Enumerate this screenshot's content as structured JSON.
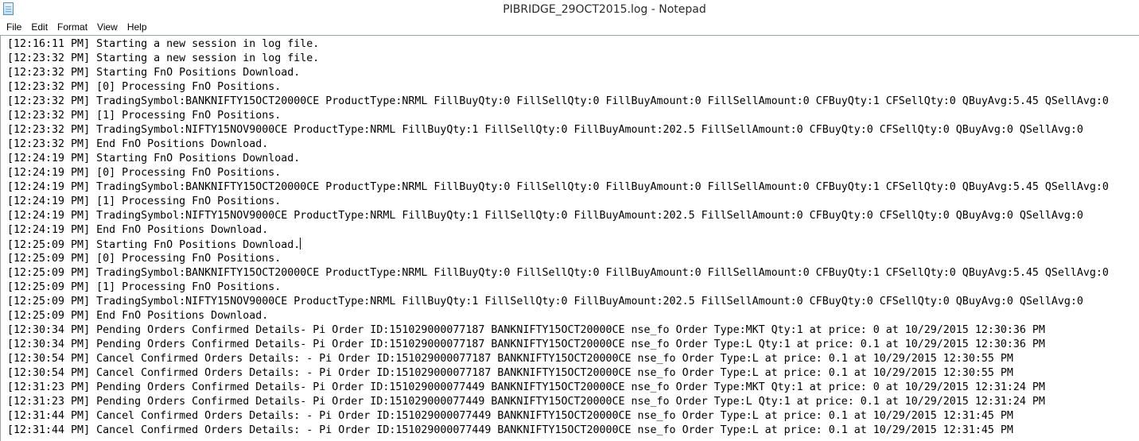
{
  "window": {
    "title": "PIBRIDGE_29OCT2015.log - Notepad",
    "icon": "notepad-icon"
  },
  "menu": [
    "File",
    "Edit",
    "Format",
    "View",
    "Help"
  ],
  "log_lines": [
    "[12:16:11 PM] Starting a new session in log file.",
    "[12:23:32 PM] Starting a new session in log file.",
    "[12:23:32 PM] Starting FnO Positions Download.",
    "[12:23:32 PM] [0] Processing FnO Positions.",
    "[12:23:32 PM] TradingSymbol:BANKNIFTY15OCT20000CE ProductType:NRML FillBuyQty:0 FillSellQty:0 FillBuyAmount:0 FillSellAmount:0 CFBuyQty:1 CFSellQty:0 QBuyAvg:5.45 QSellAvg:0",
    "[12:23:32 PM] [1] Processing FnO Positions.",
    "[12:23:32 PM] TradingSymbol:NIFTY15NOV9000CE ProductType:NRML FillBuyQty:1 FillSellQty:0 FillBuyAmount:202.5 FillSellAmount:0 CFBuyQty:0 CFSellQty:0 QBuyAvg:0 QSellAvg:0",
    "[12:23:32 PM] End FnO Positions Download.",
    "[12:24:19 PM] Starting FnO Positions Download.",
    "[12:24:19 PM] [0] Processing FnO Positions.",
    "[12:24:19 PM] TradingSymbol:BANKNIFTY15OCT20000CE ProductType:NRML FillBuyQty:0 FillSellQty:0 FillBuyAmount:0 FillSellAmount:0 CFBuyQty:1 CFSellQty:0 QBuyAvg:5.45 QSellAvg:0",
    "[12:24:19 PM] [1] Processing FnO Positions.",
    "[12:24:19 PM] TradingSymbol:NIFTY15NOV9000CE ProductType:NRML FillBuyQty:1 FillSellQty:0 FillBuyAmount:202.5 FillSellAmount:0 CFBuyQty:0 CFSellQty:0 QBuyAvg:0 QSellAvg:0",
    "[12:24:19 PM] End FnO Positions Download.",
    "[12:25:09 PM] Starting FnO Positions Download.",
    "[12:25:09 PM] [0] Processing FnO Positions.",
    "[12:25:09 PM] TradingSymbol:BANKNIFTY15OCT20000CE ProductType:NRML FillBuyQty:0 FillSellQty:0 FillBuyAmount:0 FillSellAmount:0 CFBuyQty:1 CFSellQty:0 QBuyAvg:5.45 QSellAvg:0",
    "[12:25:09 PM] [1] Processing FnO Positions.",
    "[12:25:09 PM] TradingSymbol:NIFTY15NOV9000CE ProductType:NRML FillBuyQty:1 FillSellQty:0 FillBuyAmount:202.5 FillSellAmount:0 CFBuyQty:0 CFSellQty:0 QBuyAvg:0 QSellAvg:0",
    "[12:25:09 PM] End FnO Positions Download.",
    "[12:30:34 PM] Pending Orders Confirmed Details- Pi Order ID:151029000077187 BANKNIFTY15OCT20000CE nse_fo Order Type:MKT Qty:1 at price: 0 at 10/29/2015 12:30:36 PM",
    "[12:30:34 PM] Pending Orders Confirmed Details- Pi Order ID:151029000077187 BANKNIFTY15OCT20000CE nse_fo Order Type:L Qty:1 at price: 0.1 at 10/29/2015 12:30:36 PM",
    "[12:30:54 PM] Cancel Confirmed Orders Details: - Pi Order ID:151029000077187 BANKNIFTY15OCT20000CE nse_fo Order Type:L at price: 0.1 at 10/29/2015 12:30:55 PM",
    "[12:30:54 PM] Cancel Confirmed Orders Details: - Pi Order ID:151029000077187 BANKNIFTY15OCT20000CE nse_fo Order Type:L at price: 0.1 at 10/29/2015 12:30:55 PM",
    "[12:31:23 PM] Pending Orders Confirmed Details- Pi Order ID:151029000077449 BANKNIFTY15OCT20000CE nse_fo Order Type:MKT Qty:1 at price: 0 at 10/29/2015 12:31:24 PM",
    "[12:31:23 PM] Pending Orders Confirmed Details- Pi Order ID:151029000077449 BANKNIFTY15OCT20000CE nse_fo Order Type:L Qty:1 at price: 0.1 at 10/29/2015 12:31:24 PM",
    "[12:31:44 PM] Cancel Confirmed Orders Details: - Pi Order ID:151029000077449 BANKNIFTY15OCT20000CE nse_fo Order Type:L at price: 0.1 at 10/29/2015 12:31:45 PM",
    "[12:31:44 PM] Cancel Confirmed Orders Details: - Pi Order ID:151029000077449 BANKNIFTY15OCT20000CE nse_fo Order Type:L at price: 0.1 at 10/29/2015 12:31:45 PM"
  ],
  "caret_line_index": 14
}
